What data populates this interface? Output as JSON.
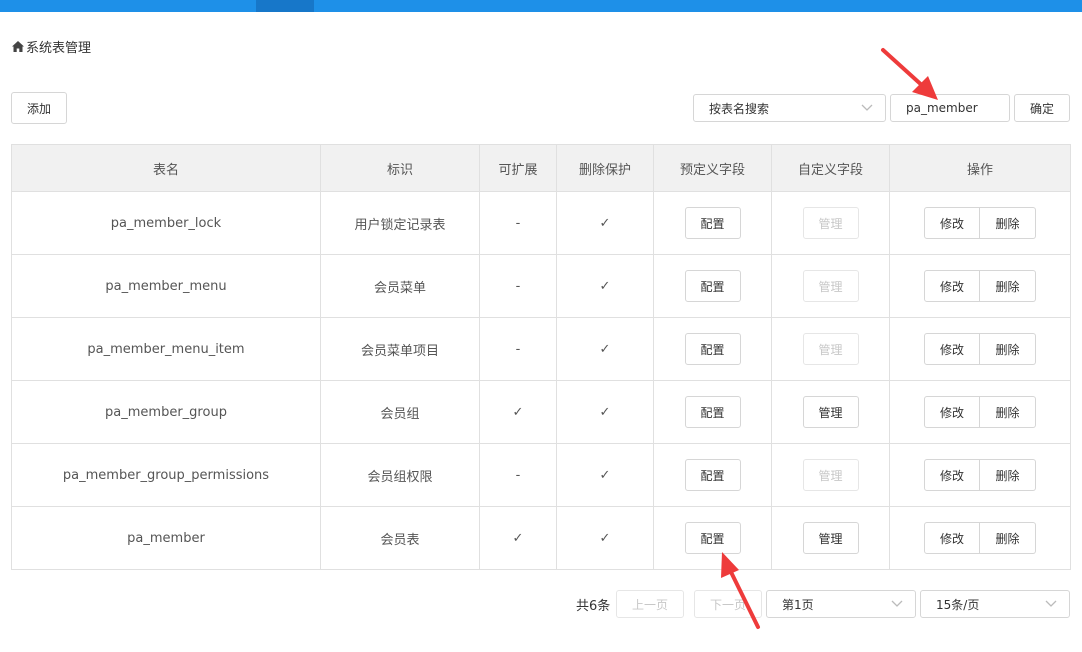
{
  "breadcrumb": {
    "icon": "home-icon",
    "text": "系统表管理"
  },
  "toolbar": {
    "add_label": "添加",
    "search_type": "按表名搜索",
    "search_value": "pa_member",
    "confirm_label": "确定"
  },
  "table": {
    "headers": [
      "表名",
      "标识",
      "可扩展",
      "删除保护",
      "预定义字段",
      "自定义字段",
      "操作"
    ],
    "rows": [
      {
        "name": "pa_member_lock",
        "label": "用户锁定记录表",
        "extensible": "-",
        "protected": "✓",
        "config": "配置",
        "manage": "管理",
        "manage_enabled": false,
        "edit": "修改",
        "delete": "删除"
      },
      {
        "name": "pa_member_menu",
        "label": "会员菜单",
        "extensible": "-",
        "protected": "✓",
        "config": "配置",
        "manage": "管理",
        "manage_enabled": false,
        "edit": "修改",
        "delete": "删除"
      },
      {
        "name": "pa_member_menu_item",
        "label": "会员菜单项目",
        "extensible": "-",
        "protected": "✓",
        "config": "配置",
        "manage": "管理",
        "manage_enabled": false,
        "edit": "修改",
        "delete": "删除"
      },
      {
        "name": "pa_member_group",
        "label": "会员组",
        "extensible": "✓",
        "protected": "✓",
        "config": "配置",
        "manage": "管理",
        "manage_enabled": true,
        "edit": "修改",
        "delete": "删除"
      },
      {
        "name": "pa_member_group_permissions",
        "label": "会员组权限",
        "extensible": "-",
        "protected": "✓",
        "config": "配置",
        "manage": "管理",
        "manage_enabled": false,
        "edit": "修改",
        "delete": "删除"
      },
      {
        "name": "pa_member",
        "label": "会员表",
        "extensible": "✓",
        "protected": "✓",
        "config": "配置",
        "manage": "管理",
        "manage_enabled": true,
        "edit": "修改",
        "delete": "删除"
      }
    ]
  },
  "pagination": {
    "total": "共6条",
    "prev_label": "上一页",
    "next_label": "下一页",
    "page": "第1页",
    "page_size": "15条/页"
  },
  "colors": {
    "topbar": "#1e90e8",
    "topbar_active": "#1777c9",
    "annotation_arrow": "#ee3b3b"
  }
}
